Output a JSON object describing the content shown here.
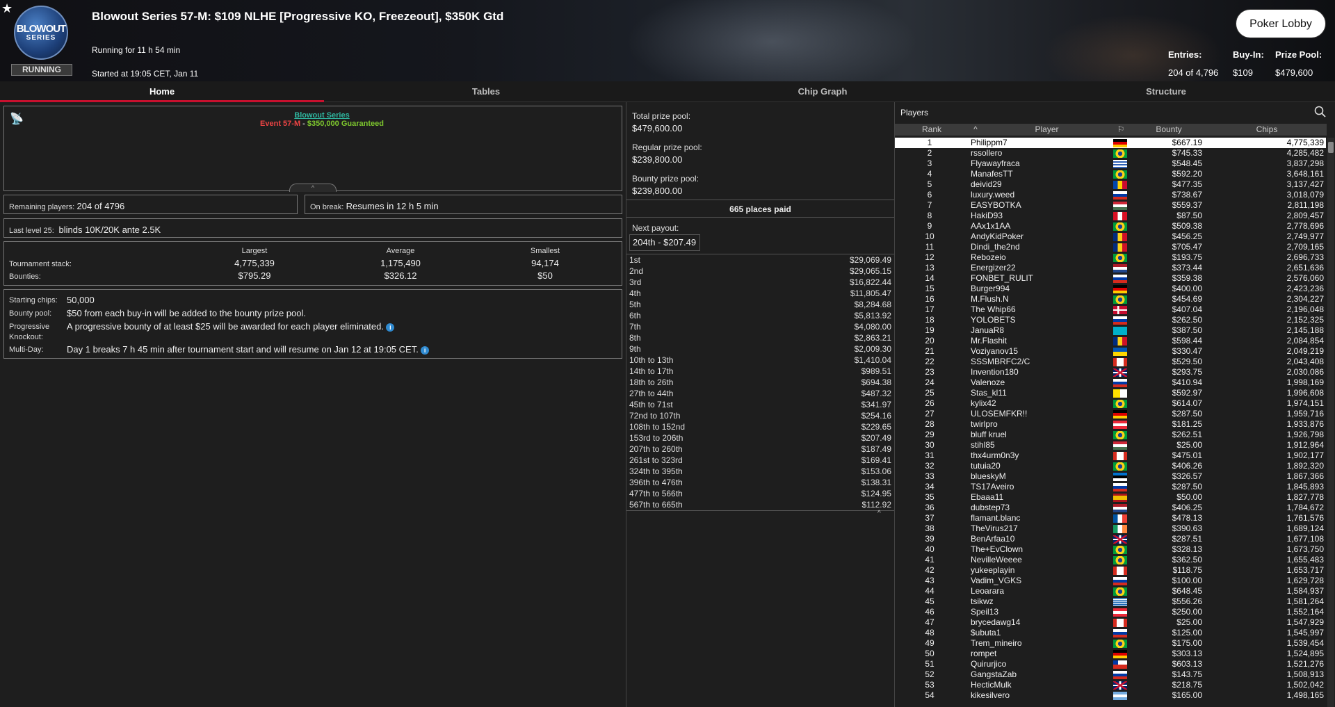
{
  "header": {
    "title": "Blowout Series 57-M: $109 NLHE [Progressive KO, Freezeout], $350K Gtd",
    "running_for": "Running for 11 h 54 min",
    "started": "Started at 19:05 CET, Jan 11",
    "status": "RUNNING",
    "logo_line1": "BLOWOUT",
    "logo_line2": "SERIES",
    "lobby_button": "Poker Lobby",
    "entries_label": "Entries:",
    "entries_value": "204 of 4,796",
    "buyin_label": "Buy-In:",
    "buyin_value": "$109",
    "prize_label": "Prize Pool:",
    "prize_value": "$479,600"
  },
  "tabs": [
    "Home",
    "Tables",
    "Chip Graph",
    "Structure"
  ],
  "home": {
    "series_link": "Blowout Series",
    "event": "Event 57-M",
    "dash": " - ",
    "guarantee": "$350,000 Guaranteed",
    "remaining_label": "Remaining players:",
    "remaining_value": "204 of 4796",
    "break_label": "On break:",
    "break_value": "Resumes in 12 h 5 min",
    "last_level_label": "Last level 25:",
    "last_level_value": "blinds 10K/20K ante 2.5K",
    "stats": {
      "h_largest": "Largest",
      "h_average": "Average",
      "h_smallest": "Smallest",
      "stack_label": "Tournament stack:",
      "stack": [
        "4,775,339",
        "1,175,490",
        "94,174"
      ],
      "bounty_label": "Bounties:",
      "bounty": [
        "$795.29",
        "$326.12",
        "$50"
      ]
    },
    "info": {
      "start_label": "Starting chips:",
      "start_value": "50,000",
      "pool_label": "Bounty pool:",
      "pool_value": "$50 from each buy-in will be added to the bounty prize pool.",
      "pko_label1": "Progressive",
      "pko_label2": "Knockout:",
      "pko_value": "A progressive bounty of at least $25 will be awarded for each player eliminated.",
      "md_label": "Multi-Day:",
      "md_value": "Day 1 breaks 7 h 45 min after tournament start and will resume on Jan 12 at 19:05 CET."
    }
  },
  "prize": {
    "total_label": "Total prize pool:",
    "total_value": "$479,600.00",
    "regular_label": "Regular prize pool:",
    "regular_value": "$239,800.00",
    "bounty_label": "Bounty prize pool:",
    "bounty_value": "$239,800.00",
    "places": "665 places paid",
    "next_label": "Next payout:",
    "next_value": "204th - $207.49",
    "payouts": [
      [
        "1st",
        "$29,069.49"
      ],
      [
        "2nd",
        "$29,065.15"
      ],
      [
        "3rd",
        "$16,822.44"
      ],
      [
        "4th",
        "$11,805.47"
      ],
      [
        "5th",
        "$8,284.68"
      ],
      [
        "6th",
        "$5,813.92"
      ],
      [
        "7th",
        "$4,080.00"
      ],
      [
        "8th",
        "$2,863.21"
      ],
      [
        "9th",
        "$2,009.30"
      ],
      [
        "10th to 13th",
        "$1,410.04"
      ],
      [
        "14th to 17th",
        "$989.51"
      ],
      [
        "18th to 26th",
        "$694.38"
      ],
      [
        "27th to 44th",
        "$487.32"
      ],
      [
        "45th to 71st",
        "$341.97"
      ],
      [
        "72nd to 107th",
        "$254.16"
      ],
      [
        "108th to 152nd",
        "$229.65"
      ],
      [
        "153rd to 206th",
        "$207.49"
      ],
      [
        "207th to 260th",
        "$187.49"
      ],
      [
        "261st to 323rd",
        "$169.41"
      ],
      [
        "324th to 395th",
        "$153.06"
      ],
      [
        "396th to 476th",
        "$138.31"
      ],
      [
        "477th to 566th",
        "$124.95"
      ],
      [
        "567th to 665th",
        "$112.92"
      ]
    ]
  },
  "players": {
    "title": "Players",
    "cols": [
      "Rank",
      "Player",
      "Bounty",
      "Chips"
    ],
    "rows": [
      [
        1,
        "Philippm7",
        "$667.19",
        "4,775,339",
        "de"
      ],
      [
        2,
        "rssollero",
        "$745.33",
        "4,285,482",
        "br"
      ],
      [
        3,
        "Flyawayfraca",
        "$548.45",
        "3,837,298",
        "uy"
      ],
      [
        4,
        "ManafesTT",
        "$592.20",
        "3,648,161",
        "br"
      ],
      [
        5,
        "deivid29",
        "$477.35",
        "3,137,427",
        "md"
      ],
      [
        6,
        "luxury.weed",
        "$738.67",
        "3,018,079",
        "ru"
      ],
      [
        7,
        "EASYBOTKA",
        "$559.37",
        "2,811,198",
        "hu"
      ],
      [
        8,
        "HakiD93",
        "$87.50",
        "2,809,457",
        "pe"
      ],
      [
        9,
        "AAx1x1AA",
        "$509.38",
        "2,778,696",
        "br"
      ],
      [
        10,
        "AndyKidPoker",
        "$456.25",
        "2,749,977",
        "ro"
      ],
      [
        11,
        "Dindi_the2nd",
        "$705.47",
        "2,709,165",
        "ro"
      ],
      [
        12,
        "Rebozeio",
        "$193.75",
        "2,696,733",
        "br"
      ],
      [
        13,
        "Energizer22",
        "$373.44",
        "2,651,636",
        "nl"
      ],
      [
        14,
        "FONBET_RULIT",
        "$359.38",
        "2,576,060",
        "ru"
      ],
      [
        15,
        "Burger994",
        "$400.00",
        "2,423,236",
        "de"
      ],
      [
        16,
        "M.Flush.N",
        "$454.69",
        "2,304,227",
        "br"
      ],
      [
        17,
        "The Whip66",
        "$407.04",
        "2,196,048",
        "dk"
      ],
      [
        18,
        "YOLOBETS",
        "$262.50",
        "2,152,325",
        "ru"
      ],
      [
        19,
        "JanuaR8",
        "$387.50",
        "2,145,188",
        "kz"
      ],
      [
        20,
        "Mr.Flashit",
        "$598.44",
        "2,084,854",
        "ro"
      ],
      [
        21,
        "Voziyanov15",
        "$330.47",
        "2,049,219",
        "ua"
      ],
      [
        22,
        "SSSMBRFC2/C",
        "$529.50",
        "2,043,408",
        "ca"
      ],
      [
        23,
        "Invention180",
        "$293.75",
        "2,030,086",
        "gb"
      ],
      [
        24,
        "Valenoze",
        "$410.94",
        "1,998,169",
        "ru"
      ],
      [
        25,
        "Stas_kl11",
        "$592.97",
        "1,996,608",
        "va"
      ],
      [
        26,
        "kylix42",
        "$614.07",
        "1,974,151",
        "br"
      ],
      [
        27,
        "ULOSEMFKR!!",
        "$287.50",
        "1,959,716",
        "de"
      ],
      [
        28,
        "twirlpro",
        "$181.25",
        "1,933,876",
        "at"
      ],
      [
        29,
        "bluff kruel",
        "$262.51",
        "1,926,798",
        "br"
      ],
      [
        30,
        "stihl85",
        "$25.00",
        "1,912,964",
        "hu"
      ],
      [
        31,
        "thx4urm0n3y",
        "$475.01",
        "1,902,177",
        "ca"
      ],
      [
        32,
        "tutuia20",
        "$406.26",
        "1,892,320",
        "br"
      ],
      [
        33,
        "blueskyM",
        "$326.57",
        "1,867,366",
        "ee"
      ],
      [
        34,
        "TS17Aveiro",
        "$287.50",
        "1,845,893",
        "ru"
      ],
      [
        35,
        "Ebaaa11",
        "$50.00",
        "1,827,778",
        "es"
      ],
      [
        36,
        "dubstep73",
        "$406.25",
        "1,784,672",
        "nl"
      ],
      [
        37,
        "flamant.blanc",
        "$478.13",
        "1,761,576",
        "fr"
      ],
      [
        38,
        "TheVirus217",
        "$390.63",
        "1,689,124",
        "ie"
      ],
      [
        39,
        "BenArfaa10",
        "$287.51",
        "1,677,108",
        "gb"
      ],
      [
        40,
        "The+EvClown",
        "$328.13",
        "1,673,750",
        "br"
      ],
      [
        41,
        "NevilleWeeee",
        "$362.50",
        "1,655,483",
        "br"
      ],
      [
        42,
        "yukeeplayin",
        "$118.75",
        "1,653,717",
        "ca"
      ],
      [
        43,
        "Vadim_VGKS",
        "$100.00",
        "1,629,728",
        "ru"
      ],
      [
        44,
        "Leoarara",
        "$648.45",
        "1,584,937",
        "br"
      ],
      [
        45,
        "tsikwz",
        "$556.26",
        "1,581,264",
        "gr"
      ],
      [
        46,
        "Speil13",
        "$250.00",
        "1,552,164",
        "at"
      ],
      [
        47,
        "brycedawg14",
        "$25.00",
        "1,547,929",
        "ca"
      ],
      [
        48,
        "$ubuta1",
        "$125.00",
        "1,545,997",
        "ru"
      ],
      [
        49,
        "Trem_mineiro",
        "$175.00",
        "1,539,454",
        "br"
      ],
      [
        50,
        "rompet",
        "$303.13",
        "1,524,895",
        "de"
      ],
      [
        51,
        "Quirurjico",
        "$603.13",
        "1,521,276",
        "cl"
      ],
      [
        52,
        "GangstaZab",
        "$143.75",
        "1,508,913",
        "ru"
      ],
      [
        53,
        "HecticMulk",
        "$218.75",
        "1,502,042",
        "gb"
      ],
      [
        54,
        "kikesilvero",
        "$165.00",
        "1,498,165",
        "ar"
      ]
    ]
  }
}
